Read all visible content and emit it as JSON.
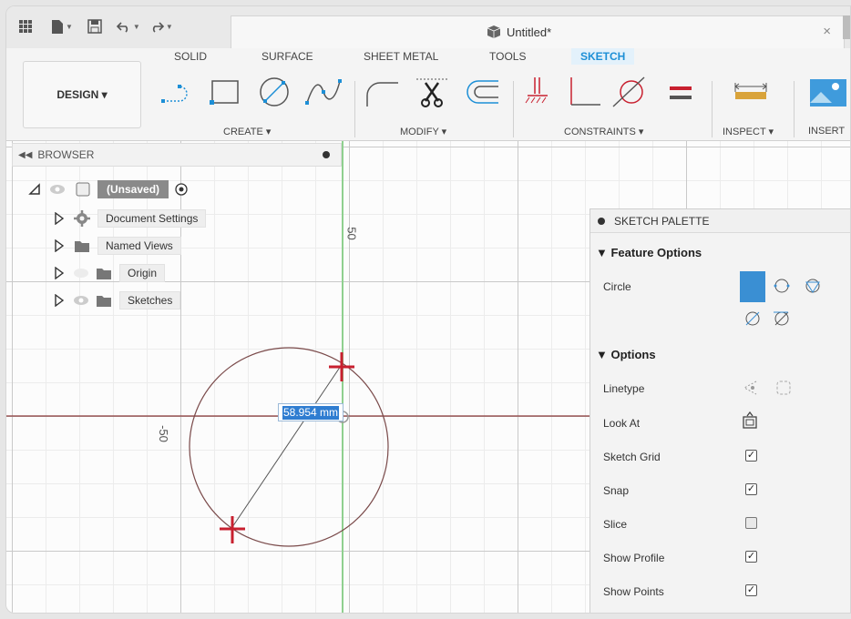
{
  "titlebar": {
    "doc_title": "Untitled*",
    "close_glyph": "×"
  },
  "toolbar": {
    "design_label": "DESIGN ▾",
    "tabs": [
      "SOLID",
      "SURFACE",
      "SHEET METAL",
      "TOOLS",
      "SKETCH"
    ],
    "active_tab": "SKETCH",
    "groups": [
      "CREATE ▾",
      "MODIFY ▾",
      "CONSTRAINTS ▾",
      "INSPECT ▾",
      "INSERT"
    ]
  },
  "browser": {
    "title": "BROWSER",
    "root": "(Unsaved)",
    "items": [
      "Document Settings",
      "Named Views",
      "Origin",
      "Sketches"
    ]
  },
  "canvas": {
    "dimension_value": "58.954 mm",
    "axis_label_vertical": "50",
    "axis_label_horizontal": "-50"
  },
  "palette": {
    "title": "SKETCH PALETTE",
    "feature_options_label": "▼ Feature Options",
    "circle_label": "Circle",
    "options_label": "▼ Options",
    "rows": [
      {
        "label": "Linetype"
      },
      {
        "label": "Look At"
      },
      {
        "label": "Sketch Grid",
        "checked": true
      },
      {
        "label": "Snap",
        "checked": true
      },
      {
        "label": "Slice",
        "checked": false
      },
      {
        "label": "Show Profile",
        "checked": true
      },
      {
        "label": "Show Points",
        "checked": true
      }
    ]
  },
  "colors": {
    "accent": "#1d8fd6",
    "constraint_red": "#c8202f",
    "axis_green": "#8fd08f",
    "axis_red": "#8a3a3a"
  }
}
